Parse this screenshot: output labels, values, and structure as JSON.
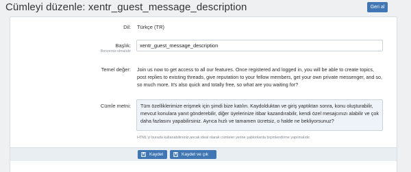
{
  "header": {
    "title": "Cümleyi düzenle: xentr_guest_message_description",
    "back_label": "Geri al"
  },
  "form": {
    "language": {
      "label": "Dil:",
      "value": "Türkçe (TR)"
    },
    "title_field": {
      "label": "Başlık:",
      "hint": "Benzersiz olmalıdır",
      "value": "xentr_guest_message_description"
    },
    "default_value": {
      "label": "Temel değer:",
      "text": "Join us now to get access to all our features. Once registered and logged in, you will be able to create topics, post replies to existing threads, give reputation to your fellow members, get your own private messenger, and so, so much more. It's also quick and totally free, so what are you waiting for?"
    },
    "phrase_text": {
      "label": "Cümle metni:",
      "value": "Tüm özelliklerimize erişmek için şimdi bize katılın. Kaydolduktan ve giriş yaptıktan sonra, konu oluşturabilir, mevcut konulara yanıt gönderebilir, diğer üyelerinize itibar kazandırabilir, kendi özel mesajcınızı alabilir ve çok daha fazlasını yapabilirsiniz. Ayrıca hızlı ve tamamen ücretsiz, o halde ne bekliyorsunuz?",
      "explain": "HTML'yi burada kullanabilirsiniz,ancak ideal olarak cümleler yerine şablonlarda biçimlendirme yapılmalıdır."
    }
  },
  "footer": {
    "save_label": "Kaydet",
    "save_exit_label": "Kaydet ve çık"
  },
  "colors": {
    "accent": "#3f76b3",
    "page_bg": "#eef0f2",
    "footer_bg": "#e9eef3",
    "textarea_bg": "#eef3f9"
  }
}
